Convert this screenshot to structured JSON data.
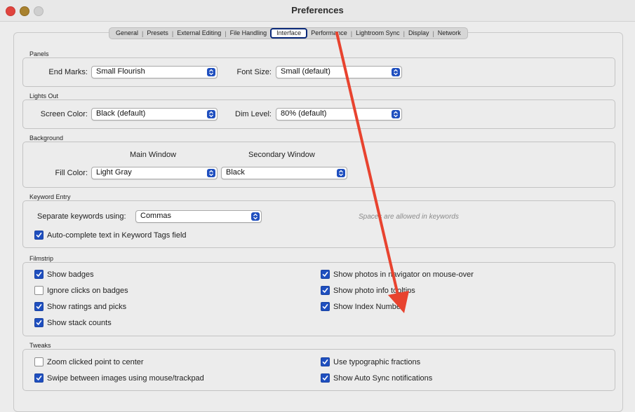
{
  "window": {
    "title": "Preferences"
  },
  "tabs": [
    "General",
    "Presets",
    "External Editing",
    "File Handling",
    "Interface",
    "Performance",
    "Lightroom Sync",
    "Display",
    "Network"
  ],
  "selected_tab": "Interface",
  "panels": {
    "title": "Panels",
    "end_marks_label": "End Marks:",
    "end_marks_value": "Small Flourish",
    "font_size_label": "Font Size:",
    "font_size_value": "Small (default)"
  },
  "lights_out": {
    "title": "Lights Out",
    "screen_color_label": "Screen Color:",
    "screen_color_value": "Black (default)",
    "dim_level_label": "Dim Level:",
    "dim_level_value": "80% (default)"
  },
  "background": {
    "title": "Background",
    "main_window_label": "Main Window",
    "secondary_window_label": "Secondary Window",
    "fill_color_label": "Fill Color:",
    "main_fill_value": "Light Gray",
    "secondary_fill_value": "Black"
  },
  "keyword_entry": {
    "title": "Keyword Entry",
    "separate_label": "Separate keywords using:",
    "separate_value": "Commas",
    "hint": "Spaces are allowed in keywords",
    "autocomplete_label": "Auto-complete text in Keyword Tags field",
    "autocomplete_checked": true
  },
  "filmstrip": {
    "title": "Filmstrip",
    "show_badges": {
      "label": "Show badges",
      "checked": true
    },
    "ignore_clicks": {
      "label": "Ignore clicks on badges",
      "checked": false
    },
    "show_ratings": {
      "label": "Show ratings and picks",
      "checked": true
    },
    "show_stack": {
      "label": "Show stack counts",
      "checked": true
    },
    "show_navigator": {
      "label": "Show photos in navigator on mouse-over",
      "checked": true
    },
    "show_info_tooltips": {
      "label": "Show photo info tooltips",
      "checked": true
    },
    "show_index": {
      "label": "Show Index Number",
      "checked": true
    }
  },
  "tweaks": {
    "title": "Tweaks",
    "zoom_clicked": {
      "label": "Zoom clicked point to center",
      "checked": false
    },
    "swipe": {
      "label": "Swipe between images using mouse/trackpad",
      "checked": true
    },
    "typographic": {
      "label": "Use typographic fractions",
      "checked": true
    },
    "auto_sync": {
      "label": "Show Auto Sync notifications",
      "checked": true
    }
  },
  "colors": {
    "accent": "#1f4fbf",
    "annotation_arrow": "#e8432f",
    "tab_highlight": "#0b2a7a"
  },
  "icons": {
    "select_stepper": "up-down-chevron-icon",
    "checkbox_check": "checkmark-icon"
  }
}
